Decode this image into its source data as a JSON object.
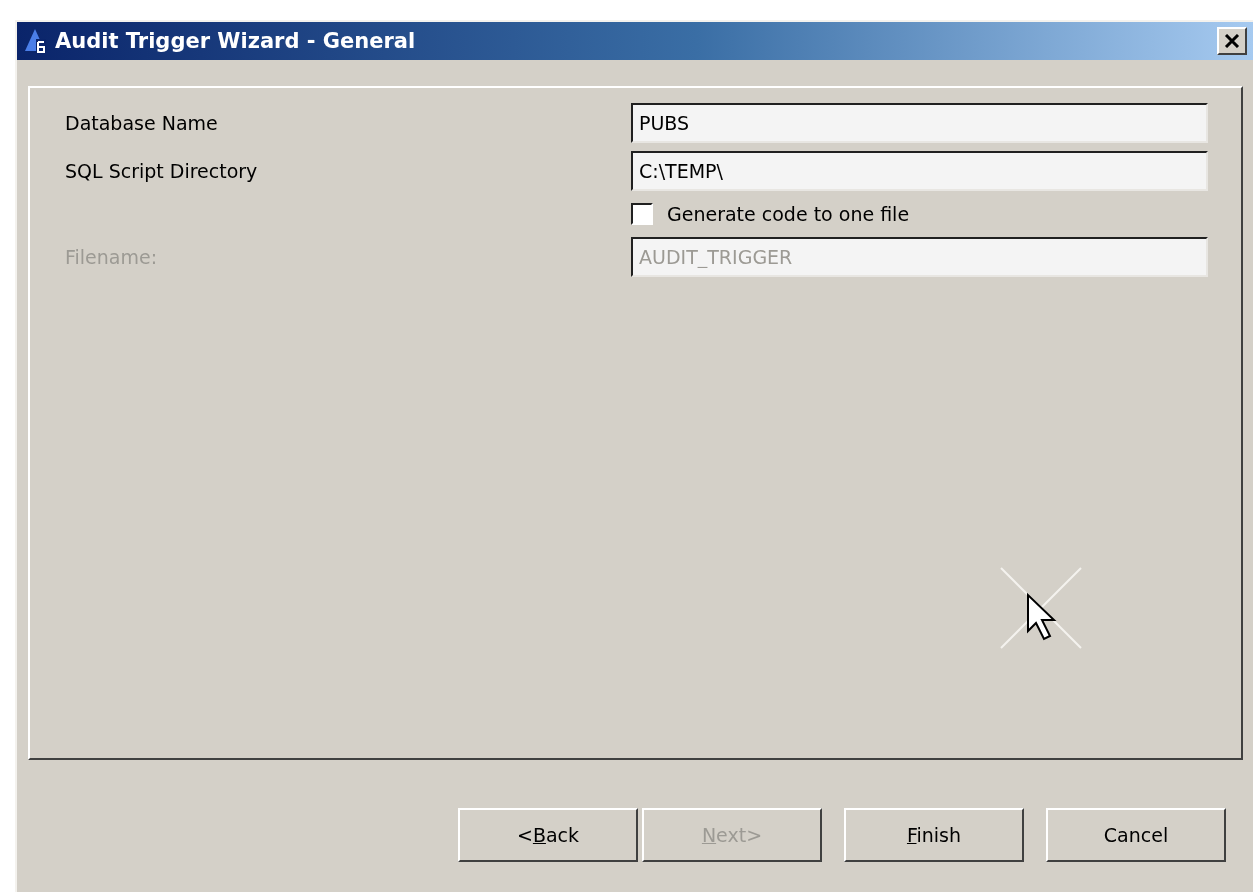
{
  "window": {
    "title": "Audit Trigger Wizard - General"
  },
  "fields": [
    {
      "label": "Database Name",
      "value": "PUBS",
      "disabled": false
    },
    {
      "label": "SQL Script Directory",
      "value": "C:\\TEMP\\",
      "disabled": false
    }
  ],
  "one_file": {
    "label": "Generate code to one file",
    "checked": false
  },
  "filename": {
    "label": "Filename:",
    "value": "AUDIT_TRIGGER",
    "disabled": true
  },
  "buttons": [
    {
      "before": "<",
      "key": "B",
      "after": "ack",
      "disabled": false
    },
    {
      "key": "N",
      "after": "ext>",
      "disabled": true
    },
    {
      "key": "F",
      "after": "inish",
      "disabled": false
    },
    {
      "before": "Cancel",
      "disabled": false
    }
  ]
}
